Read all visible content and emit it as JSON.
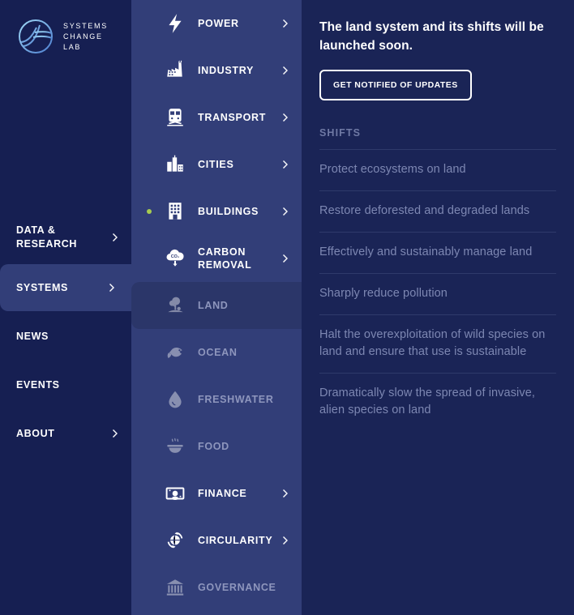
{
  "brand": {
    "name": "SYSTEMS\nCHANGE\nLAB",
    "logo_icon": "systems-change-lab-logo"
  },
  "sidebar": {
    "items": [
      {
        "label": "DATA &\nRESEARCH",
        "icon": "chevron-right-icon",
        "has_chevron": true,
        "active": false
      },
      {
        "label": "SYSTEMS",
        "icon": "chevron-right-icon",
        "has_chevron": true,
        "active": true
      },
      {
        "label": "NEWS",
        "icon": "",
        "has_chevron": false,
        "active": false
      },
      {
        "label": "EVENTS",
        "icon": "",
        "has_chevron": false,
        "active": false
      },
      {
        "label": "ABOUT",
        "icon": "chevron-right-icon",
        "has_chevron": true,
        "active": false
      }
    ]
  },
  "menu": {
    "items": [
      {
        "label": "POWER",
        "icon": "lightning-bolt-icon",
        "has_chevron": true,
        "dimmed": false,
        "selected": false,
        "dot": false
      },
      {
        "label": "INDUSTRY",
        "icon": "factory-icon",
        "has_chevron": true,
        "dimmed": false,
        "selected": false,
        "dot": false
      },
      {
        "label": "TRANSPORT",
        "icon": "train-icon",
        "has_chevron": true,
        "dimmed": false,
        "selected": false,
        "dot": false
      },
      {
        "label": "CITIES",
        "icon": "city-skyline-icon",
        "has_chevron": true,
        "dimmed": false,
        "selected": false,
        "dot": false
      },
      {
        "label": "BUILDINGS",
        "icon": "office-building-icon",
        "has_chevron": true,
        "dimmed": false,
        "selected": false,
        "dot": true
      },
      {
        "label": "CARBON\nREMOVAL",
        "icon": "co2-cloud-icon",
        "has_chevron": true,
        "dimmed": false,
        "selected": false,
        "dot": false
      },
      {
        "label": "LAND",
        "icon": "tree-land-icon",
        "has_chevron": false,
        "dimmed": true,
        "selected": true,
        "dot": false
      },
      {
        "label": "OCEAN",
        "icon": "fish-icon",
        "has_chevron": false,
        "dimmed": true,
        "selected": false,
        "dot": false
      },
      {
        "label": "FRESHWATER",
        "icon": "water-droplet-icon",
        "has_chevron": false,
        "dimmed": true,
        "selected": false,
        "dot": false
      },
      {
        "label": "FOOD",
        "icon": "food-bowl-icon",
        "has_chevron": false,
        "dimmed": true,
        "selected": false,
        "dot": false
      },
      {
        "label": "FINANCE",
        "icon": "banknotes-icon",
        "has_chevron": true,
        "dimmed": false,
        "selected": false,
        "dot": false
      },
      {
        "label": "CIRCULARITY",
        "icon": "globe-recycle-icon",
        "has_chevron": true,
        "dimmed": false,
        "selected": false,
        "dot": false
      },
      {
        "label": "GOVERNANCE",
        "icon": "institution-icon",
        "has_chevron": false,
        "dimmed": true,
        "selected": false,
        "dot": false
      }
    ]
  },
  "panel": {
    "title": "The land system and its shifts will be launched soon.",
    "notify_button": "GET NOTIFIED OF UPDATES",
    "shifts_heading": "SHIFTS",
    "shifts": [
      "Protect ecosystems on land",
      "Restore deforested and degraded lands",
      "Effectively and sustainably manage land",
      "Sharply reduce pollution",
      "Halt the overexploitation of wild species on land and ensure that use is sustainable",
      "Dramatically slow the spread of invasive, alien species on land"
    ]
  },
  "colors": {
    "sidebar_bg": "#161f52",
    "menu_bg": "#323e78",
    "panel_bg": "#1a2456",
    "selected_row": "#2b3669",
    "accent_dot": "#a7cc50",
    "dim_text": "#8e96bd",
    "shift_text": "#7d87b2",
    "heading_muted": "#6f79a4",
    "white": "#ffffff"
  }
}
